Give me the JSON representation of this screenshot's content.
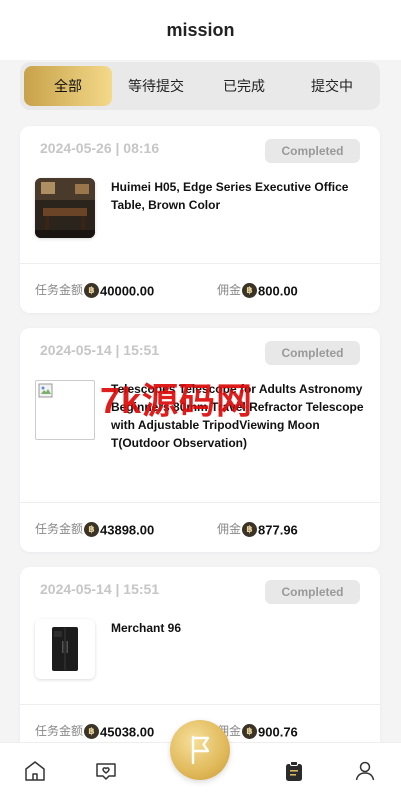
{
  "page_title": "mission",
  "tabs": [
    {
      "label": "全部",
      "active": true
    },
    {
      "label": "等待提交",
      "active": false
    },
    {
      "label": "已完成",
      "active": false
    },
    {
      "label": "提交中",
      "active": false
    }
  ],
  "orders": [
    {
      "date": "2024-05-26 | 08:16",
      "status": "Completed",
      "product": "Huimei H05, Edge Series Executive Office Table, Brown Color",
      "amount_label": "任务金额",
      "amount": "40000.00",
      "commission_label": "佣金",
      "commission": "800.00",
      "thumb_icon": "office-table-photo"
    },
    {
      "date": "2024-05-14 | 15:51",
      "status": "Completed",
      "product": "Telescopes Telescope for Adults Astronomy Beginners 80mm Travel Refractor Telescope with Adjustable TripodViewing Moon T(Outdoor Observation)",
      "amount_label": "任务金额",
      "amount": "43898.00",
      "commission_label": "佣金",
      "commission": "877.96",
      "thumb_icon": "broken-image-icon"
    },
    {
      "date": "2024-05-14 | 15:51",
      "status": "Completed",
      "product": "Merchant 96",
      "amount_label": "任务金额",
      "amount": "45038.00",
      "commission_label": "佣金",
      "commission": "900.76",
      "thumb_icon": "refrigerator-photo"
    }
  ],
  "coin_symbol": "฿",
  "watermark": "7k源码网",
  "nav": [
    "home-icon",
    "message-shield-icon",
    "flag-icon",
    "clipboard-icon",
    "profile-icon"
  ],
  "colors": {
    "accent_gold": "#e0b95a",
    "status_bg": "#e8e8e8",
    "watermark_red": "#dc0a0a"
  }
}
